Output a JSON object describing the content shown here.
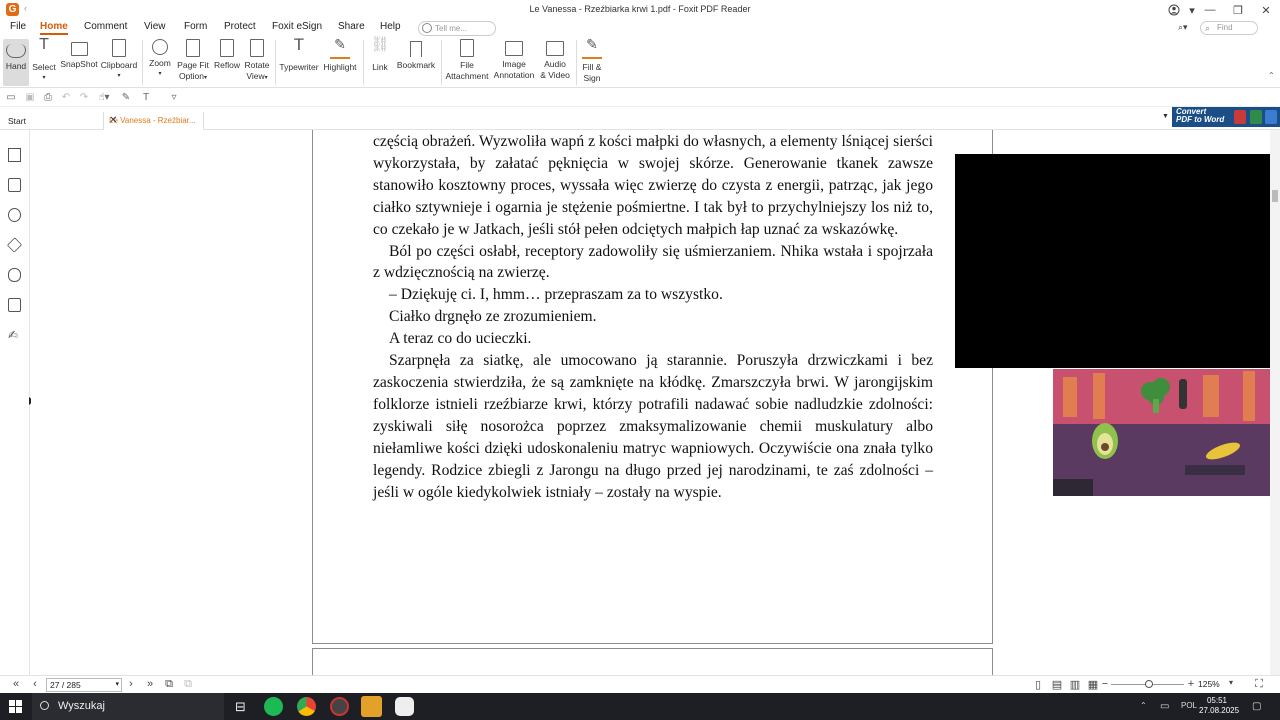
{
  "window": {
    "title": "Le Vanessa - Rzeźbiarka krwi 1.pdf - Foxit PDF Reader",
    "app_logo": "G"
  },
  "menu": {
    "items": [
      "File",
      "Home",
      "Comment",
      "View",
      "Form",
      "Protect",
      "Foxit eSign",
      "Share",
      "Help"
    ],
    "active": "Home",
    "tell_me_placeholder": "Tell me...",
    "find_placeholder": "Find"
  },
  "ribbon": {
    "hand": "Hand",
    "select": "Select",
    "snapshot": "SnapShot",
    "clipboard": "Clipboard",
    "zoom": "Zoom",
    "page_fit_1": "Page Fit",
    "page_fit_2": "Option",
    "reflow": "Reflow",
    "rotate_1": "Rotate",
    "rotate_2": "View",
    "typewriter": "Typewriter",
    "highlight": "Highlight",
    "link": "Link",
    "bookmark": "Bookmark",
    "file_attach_1": "File",
    "file_attach_2": "Attachment",
    "image_annot_1": "Image",
    "image_annot_2": "Annotation",
    "audio_video_1": "Audio",
    "audio_video_2": "& Video",
    "fill_sign_1": "Fill &",
    "fill_sign_2": "Sign"
  },
  "tabs": {
    "start": "Start",
    "document": "Le Vanessa - Rzeźbiar..."
  },
  "ad": {
    "line1": "Convert",
    "line2": "PDF to Word"
  },
  "document": {
    "paragraphs": [
      {
        "indent": false,
        "text": "częścią obrażeń. Wyzwoliła wapń z kości małpki do własnych, a elementy lśniącej sierści wykorzystała, by załatać pęknięcia w swojej skórze. Generowanie tkanek zawsze stanowiło kosztowny proces, wyssała więc zwierzę do czysta z energii, patrząc, jak jego ciałko sztywnieje i ogarnia je stężenie pośmiertne. I tak był to przychylniejszy los niż to, co czekało je w Jatkach, jeśli stół pełen odciętych małpich łap uznać za wskazówkę."
      },
      {
        "indent": true,
        "text": "Ból po części osłabł, receptory zadowoliły się uśmierzaniem. Nhika wstała i spojrzała z wdzięcznością na zwierzę."
      },
      {
        "indent": true,
        "text": "– Dziękuję ci. I, hmm… przepraszam za to wszystko."
      },
      {
        "indent": true,
        "text": "Ciałko drgnęło ze zrozumieniem."
      },
      {
        "indent": true,
        "text": "A teraz co do ucieczki."
      },
      {
        "indent": true,
        "text": "Szarpnęła za siatkę, ale umocowano ją starannie. Poruszyła drzwiczkami i bez zaskoczenia stwierdziła, że są zamknięte na kłódkę. Zmarszczyła brwi. W jarongijskim folklorze istnieli rzeźbiarze krwi, którzy potrafili nadawać sobie nadludzkie zdolności: zyskiwali siłę nosorożca poprzez zmaksymalizowanie chemii muskulatury albo niełamliwe kości dzięki udoskonaleniu matryc wapniowych. Oczywiście ona znała tylko legendy. Rodzice zbiegli z Jarongu na długo przed jej narodzinami, te zaś zdolności – jeśli w ogóle kiedykolwiek istniały – zostały na wyspie."
      }
    ]
  },
  "statusbar": {
    "page_indicator": "27 / 285",
    "zoom_level": "125%",
    "zoom_fraction": 0.52
  },
  "taskbar": {
    "search_label": "Wyszukaj",
    "language": "POL",
    "time": "05:51",
    "date": "27.08.2025"
  },
  "colors": {
    "accent": "#d65c0a",
    "taskbar": "#1d1f24",
    "ad_blue": "#1b4e86"
  }
}
